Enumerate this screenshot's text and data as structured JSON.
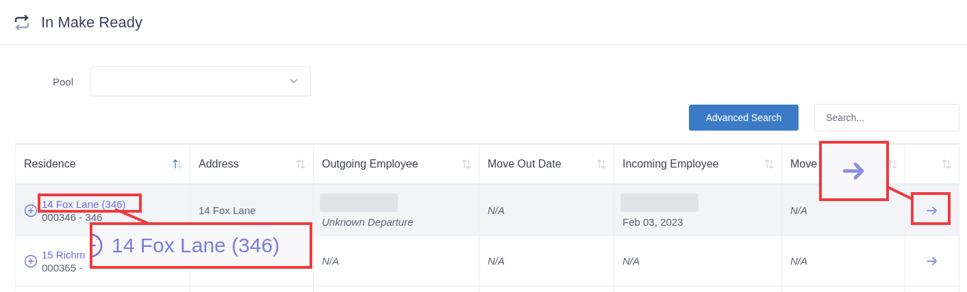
{
  "page": {
    "title": "In Make Ready"
  },
  "filters": {
    "pool": {
      "label": "Pool"
    }
  },
  "toolbar": {
    "advanced_search": "Advanced Search",
    "search": {
      "placeholder": "Search..."
    }
  },
  "table": {
    "columns": [
      {
        "label": "Residence",
        "sorted": true
      },
      {
        "label": "Address",
        "sorted": false
      },
      {
        "label": "Outgoing Employee",
        "sorted": false
      },
      {
        "label": "Move Out Date",
        "sorted": false
      },
      {
        "label": "Incoming Employee",
        "sorted": false
      },
      {
        "label": "Move",
        "sorted": false
      },
      {
        "sorted": false
      }
    ],
    "rows": [
      {
        "selected": true,
        "residence": {
          "link": "14 Fox Lane (346)",
          "code": "000346 - 346"
        },
        "address": "14 Fox Lane",
        "outgoing": {
          "redacted": true,
          "text": "Unknown Departure",
          "kind": "status"
        },
        "move_out": "N/A",
        "incoming": {
          "redacted": true,
          "text": "Feb 03, 2023",
          "kind": "date"
        },
        "move_in": "N/A"
      },
      {
        "selected": false,
        "residence": {
          "link": "15 Richm",
          "code": "000365 -"
        },
        "outgoing": {
          "redacted": false,
          "text": "N/A",
          "kind": "status"
        },
        "move_out": "N/A",
        "incoming": {
          "redacted": false,
          "text": "N/A",
          "kind": "status"
        },
        "move_in": "N/A"
      }
    ]
  },
  "callouts": [
    {
      "kind": "text",
      "text": "14 Fox Lane (346)"
    },
    {
      "kind": "icon"
    }
  ]
}
